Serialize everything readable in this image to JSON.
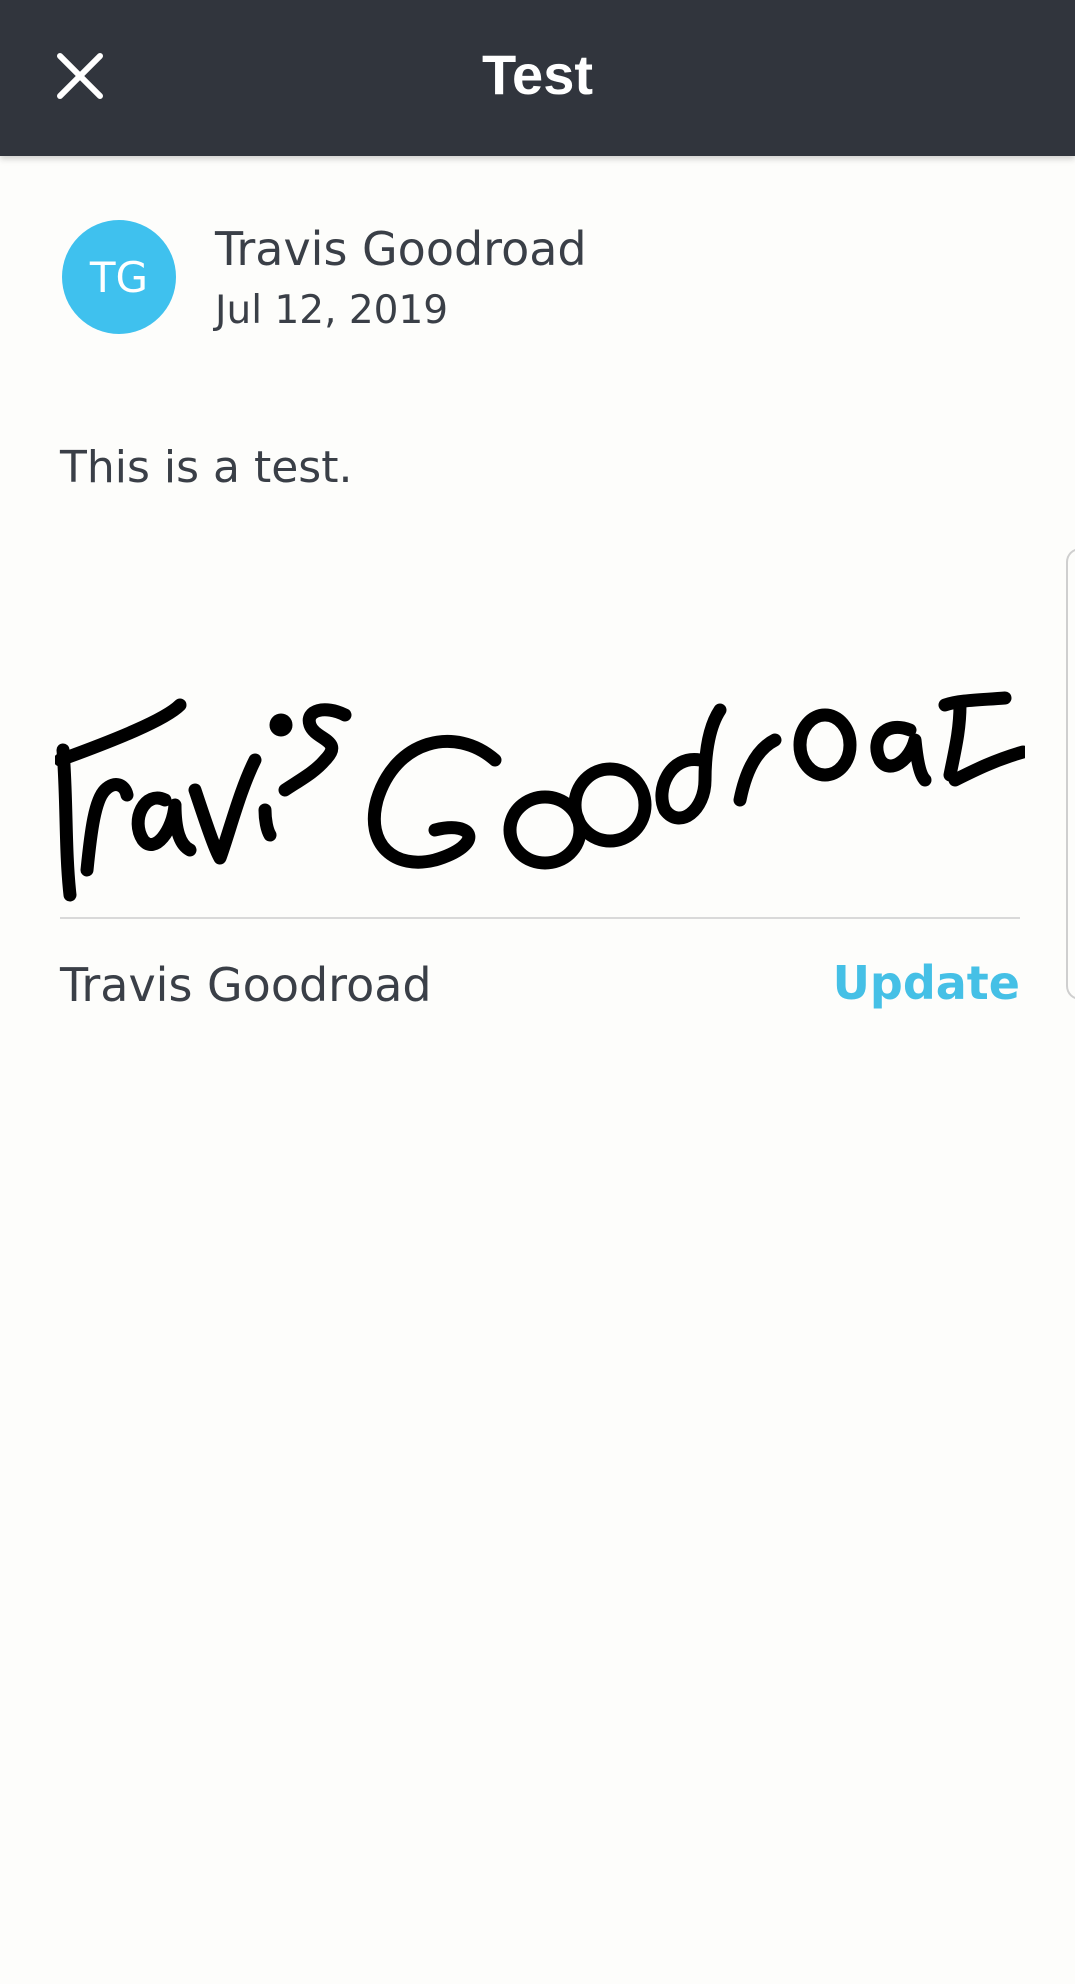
{
  "header": {
    "title": "Test",
    "close_icon": "close-icon"
  },
  "post": {
    "avatar_initials": "TG",
    "avatar_color": "#3fc1ee",
    "author": "Travis Goodroad",
    "date": "Jul 12, 2019",
    "body": "This is a test."
  },
  "signature": {
    "handwritten_text": "Travis Goodroad",
    "signer_name": "Travis Goodroad",
    "update_label": "Update",
    "accent_color": "#45c0e6"
  }
}
